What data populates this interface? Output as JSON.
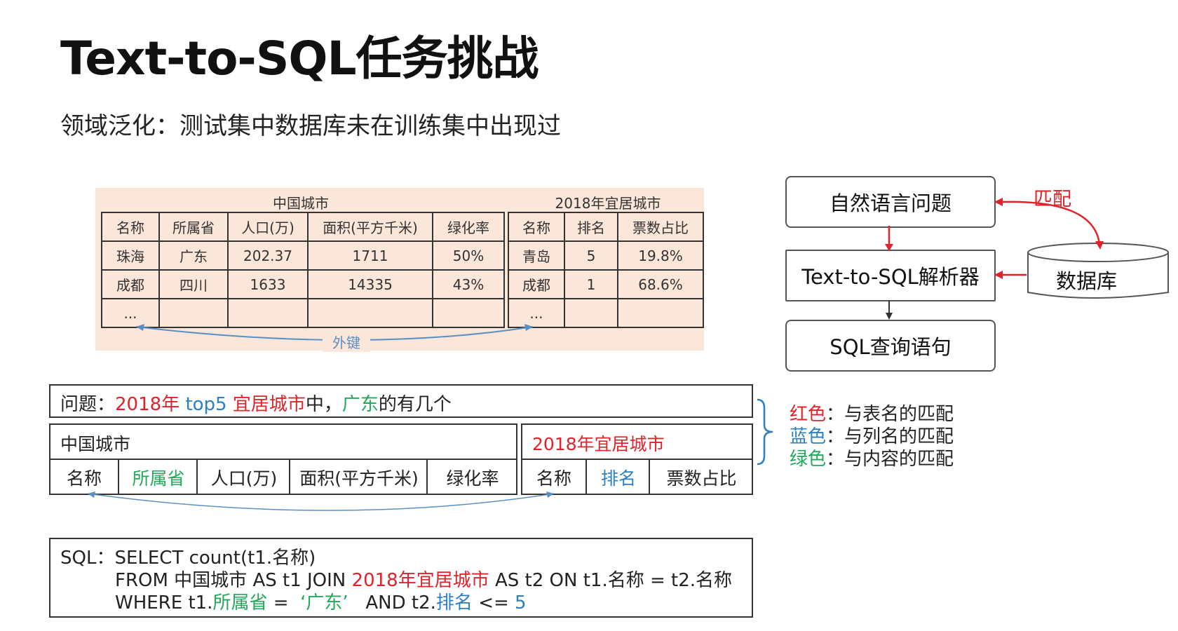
{
  "title": "Text-to-SQL任务挑战",
  "subtitle": "领域泛化：测试集中数据库未在训练集中出现过",
  "example": {
    "table1": {
      "caption": "中国城市",
      "headers": [
        "名称",
        "所属省",
        "人口(万)",
        "面积(平方千米)",
        "绿化率"
      ],
      "rows": [
        [
          "珠海",
          "广东",
          "202.37",
          "1711",
          "50%"
        ],
        [
          "成都",
          "四川",
          "1633",
          "14335",
          "43%"
        ],
        [
          "...",
          "",
          "",
          "",
          ""
        ]
      ]
    },
    "table2": {
      "caption": "2018年宜居城市",
      "headers": [
        "名称",
        "排名",
        "票数占比"
      ],
      "rows": [
        [
          "青岛",
          "5",
          "19.8%"
        ],
        [
          "成都",
          "1",
          "68.6%"
        ],
        [
          "...",
          "",
          ""
        ]
      ]
    },
    "foreign_key_label": "外键"
  },
  "flow": {
    "nl_question": "自然语言问题",
    "parser": "Text-to-SQL解析器",
    "sql_query": "SQL查询语句",
    "database": "数据库",
    "match": "匹配"
  },
  "question": {
    "prefix": "问题：",
    "part_year_red": "2018年",
    "part_top5_blue": "top5",
    "part_city_red": "宜居城市",
    "part_mid": "中，",
    "part_guangdong_green": "广东",
    "part_end": "的有几个"
  },
  "schema": {
    "table1_name": "中国城市",
    "table1_columns": [
      "名称",
      "所属省",
      "人口(万)",
      "面积(平方千米)",
      "绿化率"
    ],
    "table2_name": "2018年宜居城市",
    "table2_columns": [
      "名称",
      "排名",
      "票数占比"
    ]
  },
  "legend": {
    "red_word": "红色",
    "red_desc": "：与表名的匹配",
    "blue_word": "蓝色",
    "blue_desc": "：与列名的匹配",
    "green_word": "绿色",
    "green_desc": "：与内容的匹配"
  },
  "sql": {
    "l1": "SQL：SELECT count(t1.名称)",
    "l2_a": "FROM 中国城市 AS t1 JOIN ",
    "l2_b": "2018年宜居城市",
    "l2_c": " AS t2 ON t1.名称 = t2.名称",
    "l3_a": "WHERE t1.",
    "l3_b": "所属省",
    "l3_c": " =  ",
    "l3_d": "‘广东’",
    "l3_e": "   AND t2.",
    "l3_f": "排名",
    "l3_g": " <= ",
    "l3_h": "5"
  },
  "colors": {
    "red": "#e0232a",
    "blue": "#2c7fc0",
    "green": "#22a85a",
    "panel": "#fbe6da"
  }
}
